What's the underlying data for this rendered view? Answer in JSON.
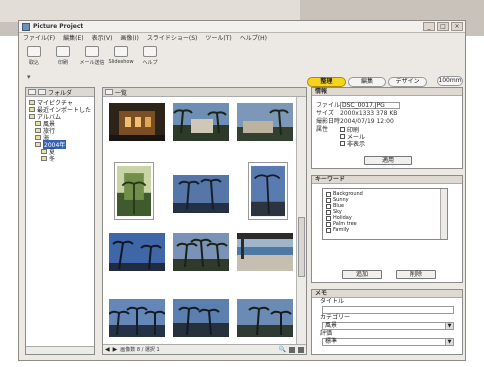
{
  "window": {
    "title": "Picture Project",
    "min": "_",
    "max": "□",
    "close": "×"
  },
  "menu": [
    "ファイル(F)",
    "編集(E)",
    "表示(V)",
    "画像(I)",
    "スライドショー(S)",
    "ツール(T)",
    "ヘルプ(H)"
  ],
  "toolbar": [
    {
      "label": "取込",
      "icon": "import-icon"
    },
    {
      "label": "印刷",
      "icon": "print-icon"
    },
    {
      "label": "メール送信",
      "icon": "mail-icon"
    },
    {
      "label": "Slideshow",
      "icon": "slideshow-icon"
    },
    {
      "label": "ヘルプ",
      "icon": "help-icon"
    }
  ],
  "mode_tabs": [
    {
      "label": "整理",
      "active": true
    },
    {
      "label": "編集",
      "active": false
    },
    {
      "label": "デザイン",
      "active": false
    }
  ],
  "zoom": "100mm",
  "tree": {
    "header": "フォルダ",
    "items": [
      {
        "label": "マイピクチャ",
        "level": 1,
        "selected": false
      },
      {
        "label": "最近インポートした",
        "level": 1,
        "selected": false
      },
      {
        "label": "アルバム",
        "level": 1,
        "selected": false
      },
      {
        "label": "風景",
        "level": 2,
        "selected": false
      },
      {
        "label": "旅行",
        "level": 2,
        "selected": false
      },
      {
        "label": "海",
        "level": 2,
        "selected": false
      },
      {
        "label": "2004年",
        "level": 2,
        "selected": true
      },
      {
        "label": "夏",
        "level": 3,
        "selected": false
      },
      {
        "label": "冬",
        "level": 3,
        "selected": false
      }
    ]
  },
  "center": {
    "header": "一覧",
    "status": "画像数 8 / 選択 1"
  },
  "info": {
    "header": "情報",
    "filename_label": "ファイル名",
    "filename": "DSC_0017.JPG",
    "size_label": "サイズ",
    "size": "2000x1333  378 KB",
    "date_label": "撮影日時",
    "date": "2004/07/19 12:00",
    "flag_label": "属性",
    "flags": [
      "印刷",
      "メール",
      "非表示"
    ],
    "apply_button": "適用"
  },
  "keywords": {
    "header": "キーワード",
    "items": [
      "Background",
      "Sunny",
      "Blue",
      "Sky",
      "Holiday",
      "Palm tree",
      "Family"
    ],
    "add_button": "追加",
    "remove_button": "削除"
  },
  "memo": {
    "header": "メモ",
    "title_label": "タイトル",
    "title_value": "",
    "category_label": "カテゴリー",
    "category_value": "風景",
    "rating_label": "評価",
    "rating_value": "標準"
  }
}
